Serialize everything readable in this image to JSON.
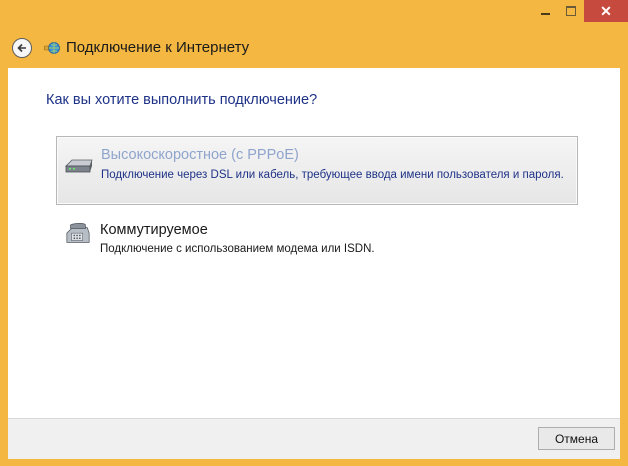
{
  "window": {
    "title": "Подключение к Интернету",
    "controls": {
      "minimize": "minimize-icon",
      "maximize": "maximize-icon",
      "close": "✕"
    }
  },
  "main": {
    "question": "Как вы хотите выполнить подключение?",
    "options": [
      {
        "title": "Высокоскоростное (с PPPoE)",
        "description": "Подключение через DSL или кабель, требующее ввода имени пользователя и пароля.",
        "icon": "broadband-modem-icon",
        "highlighted": true
      },
      {
        "title": "Коммутируемое",
        "description": "Подключение с использованием модема или ISDN.",
        "icon": "dialup-phone-icon",
        "highlighted": false
      }
    ]
  },
  "footer": {
    "cancel_label": "Отмена"
  },
  "colors": {
    "frame": "#f4b742",
    "close": "#c74a3e",
    "heading": "#1e3287",
    "disabled_title": "#8fa4cc"
  }
}
